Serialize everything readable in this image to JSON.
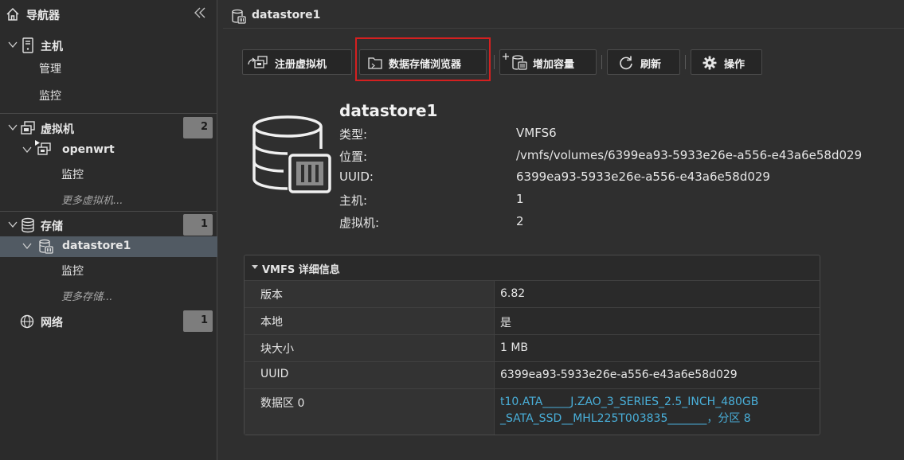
{
  "sidebar": {
    "title": "导航器",
    "host": {
      "label": "主机",
      "children": [
        "管理",
        "监控"
      ]
    },
    "vms": {
      "label": "虚拟机",
      "count": "2",
      "vm_name": "openwrt",
      "vm_child": "监控",
      "more": "更多虚拟机..."
    },
    "storage": {
      "label": "存储",
      "count": "1",
      "ds_name": "datastore1",
      "ds_child": "监控",
      "more": "更多存储..."
    },
    "network": {
      "label": "网络",
      "count": "1"
    }
  },
  "main": {
    "title": "datastore1",
    "toolbar": {
      "register_vm": "注册虚拟机",
      "datastore_browser": "数据存储浏览器",
      "increase_capacity": "增加容量",
      "refresh": "刷新",
      "actions": "操作"
    },
    "summary": {
      "name": "datastore1",
      "props": [
        {
          "key": "类型:",
          "value": "VMFS6"
        },
        {
          "key": "位置:",
          "value": "/vmfs/volumes/6399ea93-5933e26e-a556-e43a6e58d029"
        },
        {
          "key": "UUID:",
          "value": "6399ea93-5933e26e-a556-e43a6e58d029"
        },
        {
          "key": "主机:",
          "value": "1"
        },
        {
          "key": "虚拟机:",
          "value": "2"
        }
      ]
    },
    "vmfs_panel": {
      "title": "VMFS 详细信息",
      "rows": [
        {
          "key": "版本",
          "value": "6.82"
        },
        {
          "key": "本地",
          "value": "是"
        },
        {
          "key": "块大小",
          "value": "1 MB"
        },
        {
          "key": "UUID",
          "value": "6399ea93-5933e26e-a556-e43a6e58d029"
        },
        {
          "key": "数据区 0",
          "line1": "t10.ATA_____J.ZAO_3_SERIES_2.5_INCH_480GB",
          "line2": "_SATA_SSD__MHL225T003835_______，分区 8"
        }
      ]
    }
  }
}
